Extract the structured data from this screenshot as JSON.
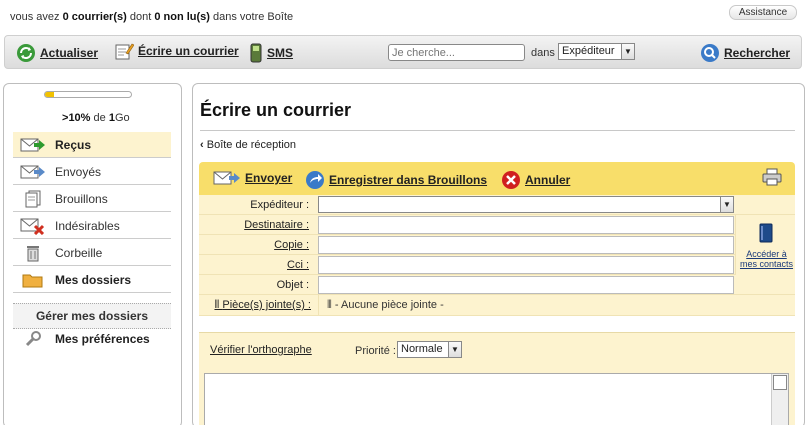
{
  "status": {
    "prefix": "vous avez",
    "mail_count": "0 courrier(s)",
    "middle": "dont",
    "unread_count": "0 non lu(s)",
    "suffix": "dans votre Boîte",
    "assist": "Assistance"
  },
  "toolbar": {
    "refresh": "Actualiser",
    "compose": "Écrire un courrier",
    "sms": "SMS",
    "search_placeholder": "Je cherche...",
    "dans": "dans",
    "search_scope": "Expéditeur",
    "search_button": "Rechercher"
  },
  "sidebar": {
    "quota_fraction": 0.1,
    "quota_percent": "10%",
    "quota_of": "de",
    "quota_total": "1",
    "quota_unit": "Go",
    "items": [
      {
        "label": "Reçus"
      },
      {
        "label": "Envoyés"
      },
      {
        "label": "Brouillons"
      },
      {
        "label": "Indésirables"
      },
      {
        "label": "Corbeille"
      },
      {
        "label": "Mes dossiers"
      }
    ],
    "manage": "Gérer mes dossiers",
    "prefs": "Mes préférences"
  },
  "compose": {
    "title": "Écrire un courrier",
    "back": "Boîte de réception",
    "actions": {
      "send": "Envoyer",
      "save_draft": "Enregistrer dans Brouillons",
      "cancel": "Annuler"
    },
    "fields": {
      "from": "Expéditeur :",
      "to": "Destinataire :",
      "cc": "Copie :",
      "bcc": "Cci :",
      "subject": "Objet :",
      "attachments": "Pièce(s) jointe(s) :",
      "no_attachment": "- Aucune pièce jointe -"
    },
    "contacts_link": "Accéder à mes contacts",
    "spellcheck": "Vérifier l'orthographe",
    "priority_label": "Priorité :",
    "priority_value": "Normale"
  },
  "colors": {
    "accent_yellow": "#f8de6a",
    "row_yellow": "#fdf3cf",
    "quota_fill": "#f2c200"
  }
}
